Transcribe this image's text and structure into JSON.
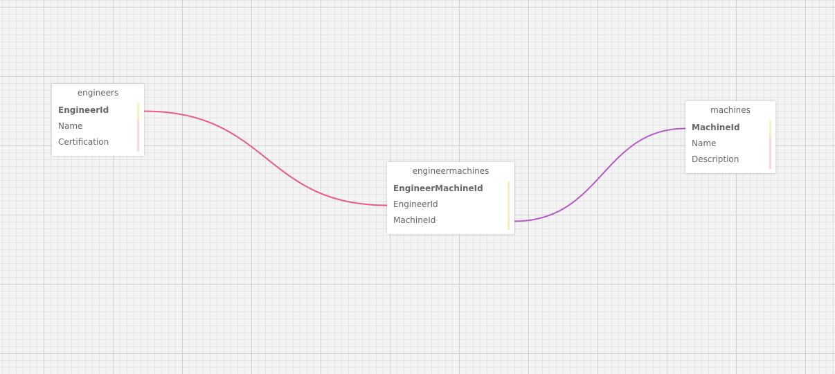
{
  "tables": [
    {
      "name": "engineers",
      "fields": [
        {
          "name": "EngineerId",
          "primary_key": true
        },
        {
          "name": "Name",
          "primary_key": false
        },
        {
          "name": "Certification",
          "primary_key": false
        }
      ]
    },
    {
      "name": "engineermachines",
      "fields": [
        {
          "name": "EngineerMachineId",
          "primary_key": true
        },
        {
          "name": "EngineerId",
          "primary_key": false
        },
        {
          "name": "MachineId",
          "primary_key": false
        }
      ]
    },
    {
      "name": "machines",
      "fields": [
        {
          "name": "MachineId",
          "primary_key": true
        },
        {
          "name": "Name",
          "primary_key": false
        },
        {
          "name": "Description",
          "primary_key": false
        }
      ]
    }
  ],
  "relations": [
    {
      "from": "engineers.EngineerId",
      "to": "engineermachines.EngineerId",
      "color": "#e8588d"
    },
    {
      "from": "engineermachines.MachineId",
      "to": "machines.MachineId",
      "color": "#b45ac8"
    }
  ],
  "colors": {
    "grid_major": "#cfcfcf",
    "grid_minor": "#e4e4e4",
    "background": "#f4f4f4",
    "bar_yellow": "#f5f0bf",
    "bar_pink": "#fbd6d8"
  }
}
